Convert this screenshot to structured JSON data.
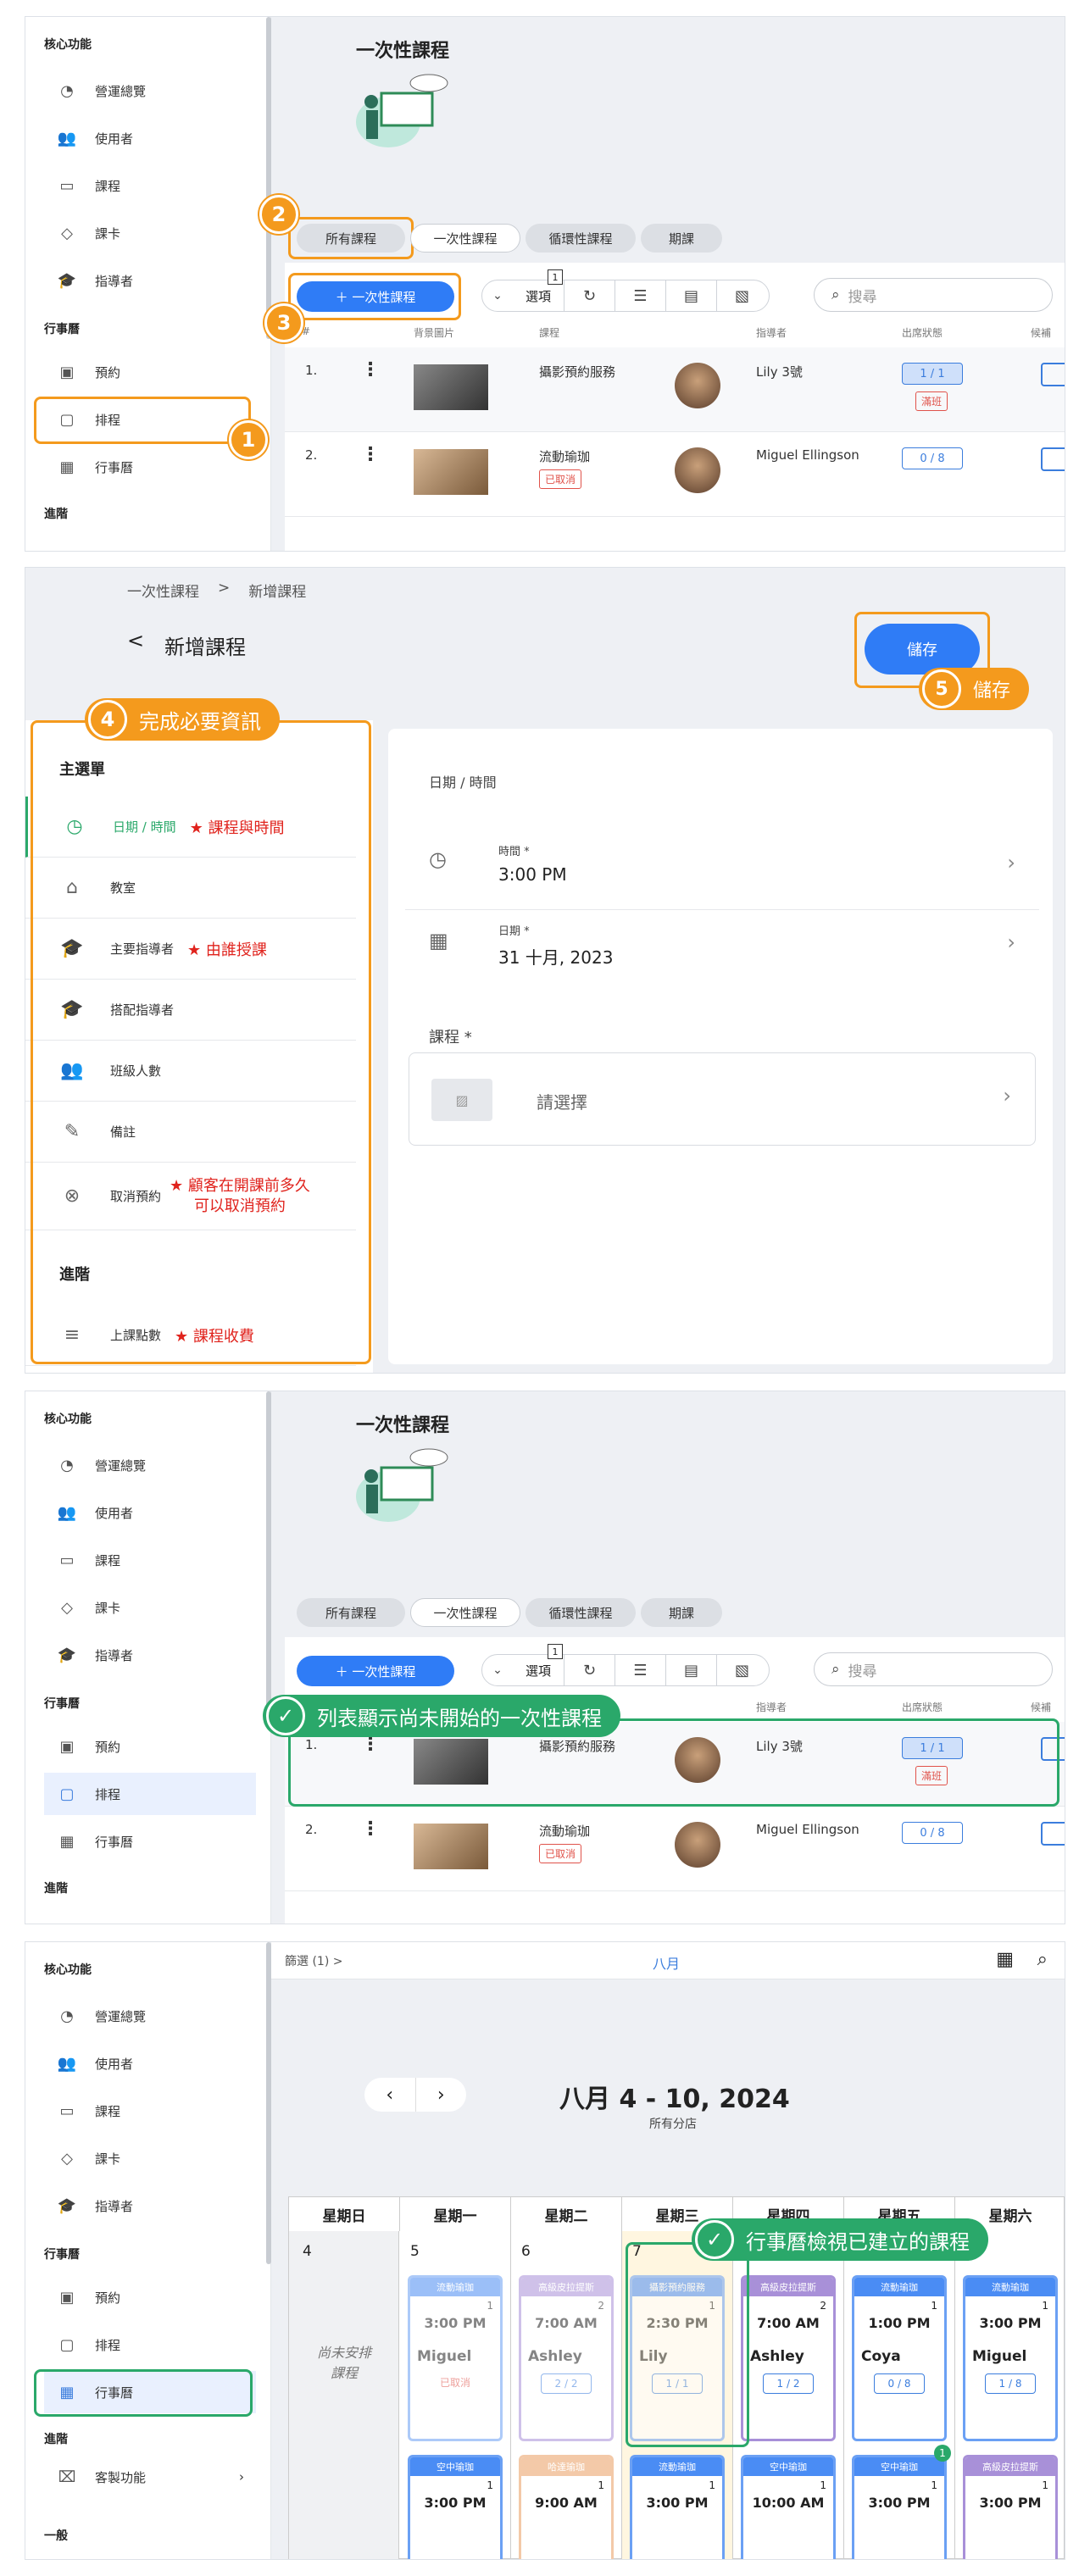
{
  "sidebar": {
    "sec_core": "核心功能",
    "items": [
      "營運總覽",
      "使用者",
      "課程",
      "課卡",
      "指導者"
    ],
    "sec_calendar": "行事曆",
    "cal_items": [
      "預約",
      "排程",
      "行事曆"
    ],
    "sec_advanced": "進階",
    "extra_item": "客製功能",
    "sec_general": "一般"
  },
  "p1": {
    "title": "一次性課程",
    "tabs": [
      "所有課程",
      "一次性課程",
      "循環性課程",
      "期課"
    ],
    "add_btn": "＋  一次性課程",
    "options_label": "選項",
    "options_badge": "1",
    "search_placeholder": "搜尋",
    "headers": [
      "#",
      "背景圖片",
      "課程",
      "指導者",
      "出席狀態",
      "候補"
    ],
    "rows": [
      {
        "num": "1.",
        "course": "攝影預約服務",
        "teacher": "Lily 3號",
        "attendance": "1 / 1",
        "tag": "滿班"
      },
      {
        "num": "2.",
        "course": "流動瑜珈",
        "tag": "已取消",
        "teacher": "Miguel Ellingson",
        "attendance": "0 / 8"
      }
    ],
    "badges": [
      "1",
      "2",
      "3"
    ]
  },
  "p2": {
    "breadcrumb": [
      "一次性課程",
      ">",
      "新增課程"
    ],
    "back": "<",
    "title": "新增課程",
    "save": "儲存",
    "callout4": "完成必要資訊",
    "callout5": "儲存",
    "badge4": "4",
    "badge5": "5",
    "menu_title": "主選單",
    "menu": [
      {
        "label": "日期 / 時間",
        "note": "★ 課程與時間"
      },
      {
        "label": "教室",
        "note": ""
      },
      {
        "label": "主要指導者",
        "note": "★ 由誰授課"
      },
      {
        "label": "搭配指導者",
        "note": ""
      },
      {
        "label": "班級人數",
        "note": ""
      },
      {
        "label": "備註",
        "note": ""
      },
      {
        "label": "取消預約",
        "note": "★ 顧客在開課前多久",
        "note2": "可以取消預約"
      }
    ],
    "advanced": "進階",
    "points": {
      "label": "上課點數",
      "note": "★ 課程收費"
    },
    "section": "日期 / 時間",
    "time_label": "時間 *",
    "time_value": "3:00 PM",
    "date_label": "日期 *",
    "date_value": "31 十月, 2023",
    "course_label": "課程 *",
    "course_placeholder": "請選擇"
  },
  "p3": {
    "callout": "列表顯示尚未開始的一次性課程"
  },
  "p4": {
    "filter": "篩選 (1) >",
    "month_top": "八月",
    "range": "八月 4 - 10, 2024",
    "branch": "所有分店",
    "days": [
      "星期日",
      "星期一",
      "星期二",
      "星期三",
      "星期四",
      "星期五",
      "星期六"
    ],
    "dates": [
      "4",
      "5",
      "6",
      "7",
      "8",
      "9",
      "10"
    ],
    "unscheduled": "尚未安排課程",
    "callout": "行事曆檢視已建立的課程",
    "events_row1": [
      {
        "head": "流動瑜珈",
        "count": "1",
        "time": "3:00 PM",
        "who": "Miguel",
        "att": "",
        "tag": "已取消"
      },
      {
        "head": "高級皮拉提斯",
        "count": "2",
        "time": "7:00 AM",
        "who": "Ashley",
        "att": "2 / 2"
      },
      {
        "head": "攝影預約服務",
        "count": "1",
        "time": "2:30 PM",
        "who": "Lily",
        "att": "1 / 1"
      },
      {
        "head": "高級皮拉提斯",
        "count": "2",
        "time": "7:00 AM",
        "who": "Ashley",
        "att": "1 / 2"
      },
      {
        "head": "流動瑜珈",
        "count": "1",
        "time": "1:00 PM",
        "who": "Coya",
        "att": "0 / 8"
      },
      {
        "head": "流動瑜珈",
        "count": "1",
        "time": "3:00 PM",
        "who": "Miguel",
        "att": "1 / 8"
      }
    ],
    "events_row2": [
      {
        "head": "空中瑜珈",
        "count": "1",
        "time": "3:00 PM"
      },
      {
        "head": "哈達瑜珈",
        "count": "1",
        "time": "9:00 AM"
      },
      {
        "head": "流動瑜珈",
        "count": "1",
        "time": "3:00 PM"
      },
      {
        "head": "空中瑜珈",
        "count": "1",
        "time": "10:00 AM"
      },
      {
        "head": "空中瑜珈",
        "count": "1",
        "time": "3:00 PM"
      },
      {
        "head": "高級皮拉提斯",
        "count": "1",
        "time": "3:00 PM"
      }
    ],
    "fri_badge": "1"
  }
}
